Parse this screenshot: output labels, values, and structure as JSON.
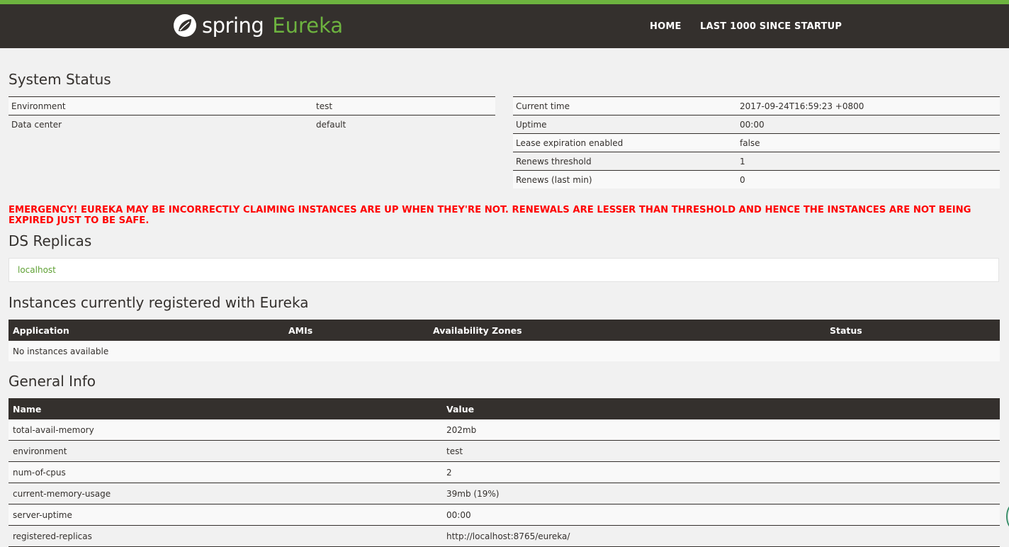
{
  "header": {
    "brand_spring": "spring",
    "brand_eureka": "Eureka",
    "nav": [
      "HOME",
      "LAST 1000 SINCE STARTUP"
    ]
  },
  "system_status": {
    "title": "System Status",
    "left": [
      {
        "key": "Environment",
        "value": "test"
      },
      {
        "key": "Data center",
        "value": "default"
      }
    ],
    "right": [
      {
        "key": "Current time",
        "value": "2017-09-24T16:59:23 +0800"
      },
      {
        "key": "Uptime",
        "value": "00:00"
      },
      {
        "key": "Lease expiration enabled",
        "value": "false"
      },
      {
        "key": "Renews threshold",
        "value": "1"
      },
      {
        "key": "Renews (last min)",
        "value": "0"
      }
    ]
  },
  "emergency": "EMERGENCY! EUREKA MAY BE INCORRECTLY CLAIMING INSTANCES ARE UP WHEN THEY'RE NOT. RENEWALS ARE LESSER THAN THRESHOLD AND HENCE THE INSTANCES ARE NOT BEING EXPIRED JUST TO BE SAFE.",
  "ds_replicas": {
    "title": "DS Replicas",
    "items": [
      "localhost"
    ]
  },
  "instances": {
    "title": "Instances currently registered with Eureka",
    "columns": [
      "Application",
      "AMIs",
      "Availability Zones",
      "Status"
    ],
    "empty_text": "No instances available"
  },
  "general_info": {
    "title": "General Info",
    "columns": [
      "Name",
      "Value"
    ],
    "rows": [
      {
        "name": "total-avail-memory",
        "value": "202mb"
      },
      {
        "name": "environment",
        "value": "test"
      },
      {
        "name": "num-of-cpus",
        "value": "2"
      },
      {
        "name": "current-memory-usage",
        "value": "39mb (19%)"
      },
      {
        "name": "server-uptime",
        "value": "00:00"
      },
      {
        "name": "registered-replicas",
        "value": "http://localhost:8765/eureka/"
      }
    ]
  },
  "colors": {
    "accent": "#6db33f",
    "navbar": "#34302d",
    "emergency": "#ff0000"
  }
}
